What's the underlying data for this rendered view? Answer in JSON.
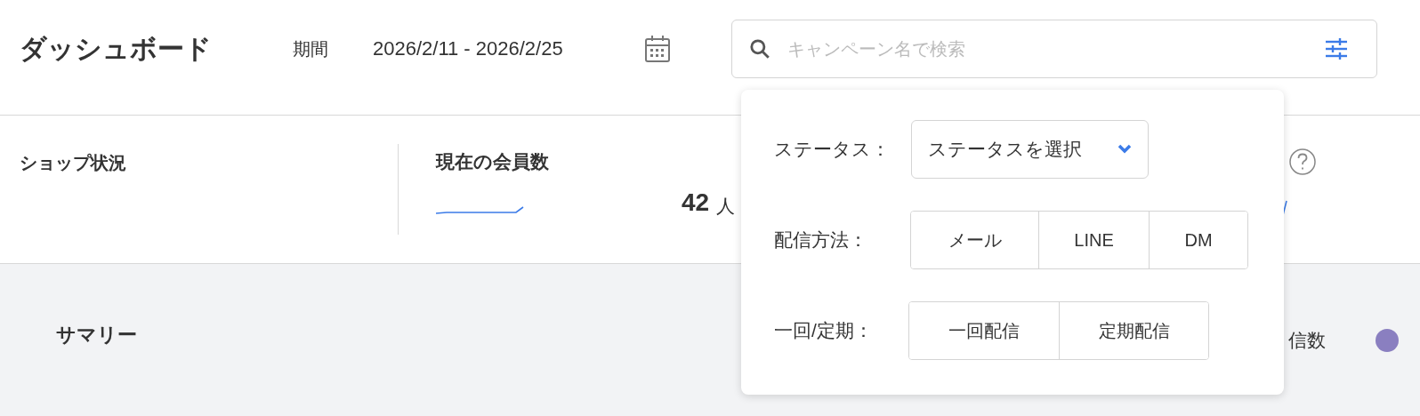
{
  "header": {
    "title": "ダッシュボード",
    "period_label": "期間",
    "period_value": "2026/2/11 - 2026/2/25"
  },
  "search": {
    "placeholder": "キャンペーン名で検索"
  },
  "shop_status": {
    "title": "ショップ状況"
  },
  "members": {
    "title": "現在の会員数",
    "value": "42",
    "unit": "人"
  },
  "summary": {
    "title": "サマリー",
    "legend_text": "信数"
  },
  "filter_popup": {
    "status": {
      "label": "ステータス：",
      "placeholder": "ステータスを選択"
    },
    "delivery_method": {
      "label": "配信方法：",
      "options": [
        {
          "label": "メール",
          "selected": false
        },
        {
          "label": "LINE",
          "selected": false
        },
        {
          "label": "DM",
          "selected": false
        }
      ]
    },
    "frequency": {
      "label": "一回/定期：",
      "options": [
        {
          "label": "一回配信",
          "selected": false
        },
        {
          "label": "定期配信",
          "selected": false
        }
      ]
    }
  }
}
